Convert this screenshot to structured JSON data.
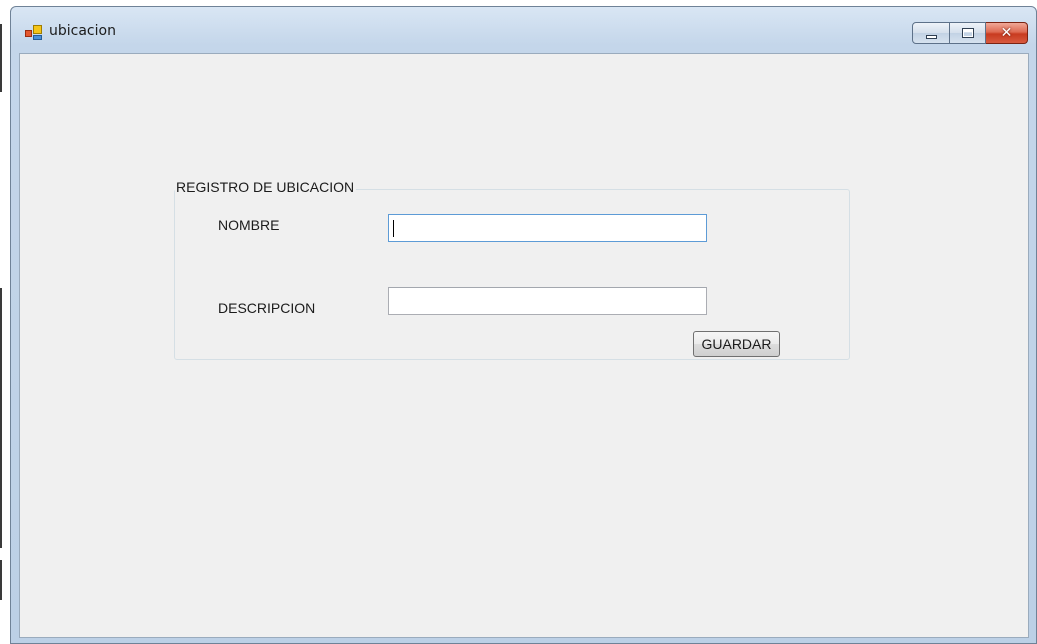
{
  "window": {
    "title": "ubicacion",
    "icon": "windows-forms-app-icon",
    "controls": {
      "minimize_icon": "minimize-icon",
      "maximize_icon": "maximize-icon",
      "close_icon": "close-icon",
      "close_glyph": "✕"
    },
    "colors": {
      "client_background": "#f0f0f0",
      "close_button": "#c83b20"
    }
  },
  "form": {
    "group_title": "REGISTRO DE UBICACION",
    "fields": {
      "nombre": {
        "label": "NOMBRE",
        "value": "",
        "focused": true
      },
      "descripcion": {
        "label": "DESCRIPCION",
        "value": ""
      }
    },
    "save_label": "GUARDAR"
  }
}
